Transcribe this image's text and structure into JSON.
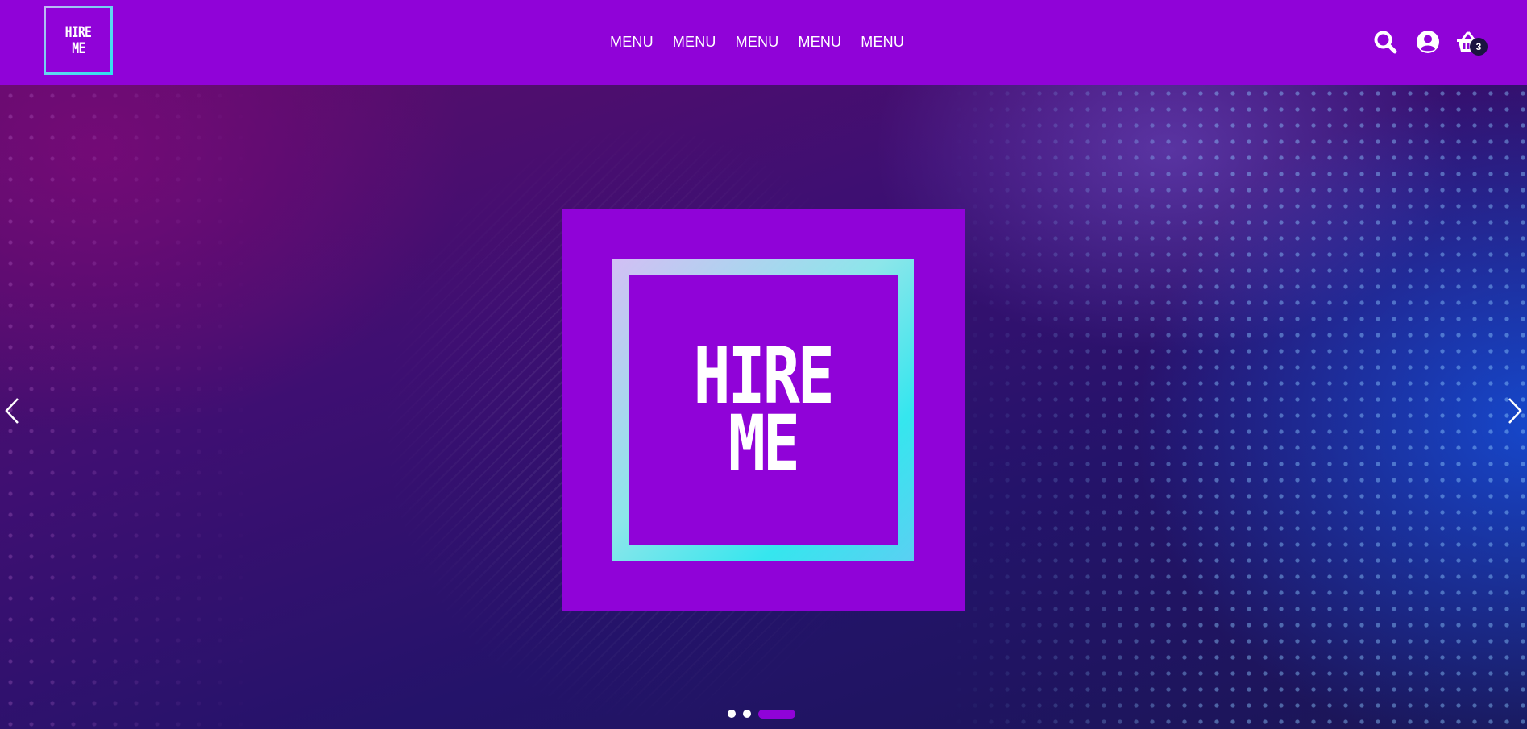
{
  "header": {
    "logo": {
      "line1": "HIRE",
      "line2": "ME"
    },
    "nav": [
      {
        "label": "MENU"
      },
      {
        "label": "MENU"
      },
      {
        "label": "MENU"
      },
      {
        "label": "MENU"
      },
      {
        "label": "MENU"
      }
    ],
    "icons": {
      "search": "search-icon",
      "account": "user-circle-icon",
      "cart": "basket-icon"
    },
    "cart_count": "3"
  },
  "hero": {
    "slide": {
      "line1": "HIRE",
      "line2": "ME"
    },
    "prev_icon": "chevron-left-icon",
    "next_icon": "chevron-right-icon",
    "pagination": {
      "total": 3,
      "active": 3
    }
  },
  "colors": {
    "brand_purple": "#9003d8",
    "frame_gradient_start": "#d2bff4",
    "frame_gradient_end": "#35e6ee",
    "badge_bg": "#1a1440"
  }
}
